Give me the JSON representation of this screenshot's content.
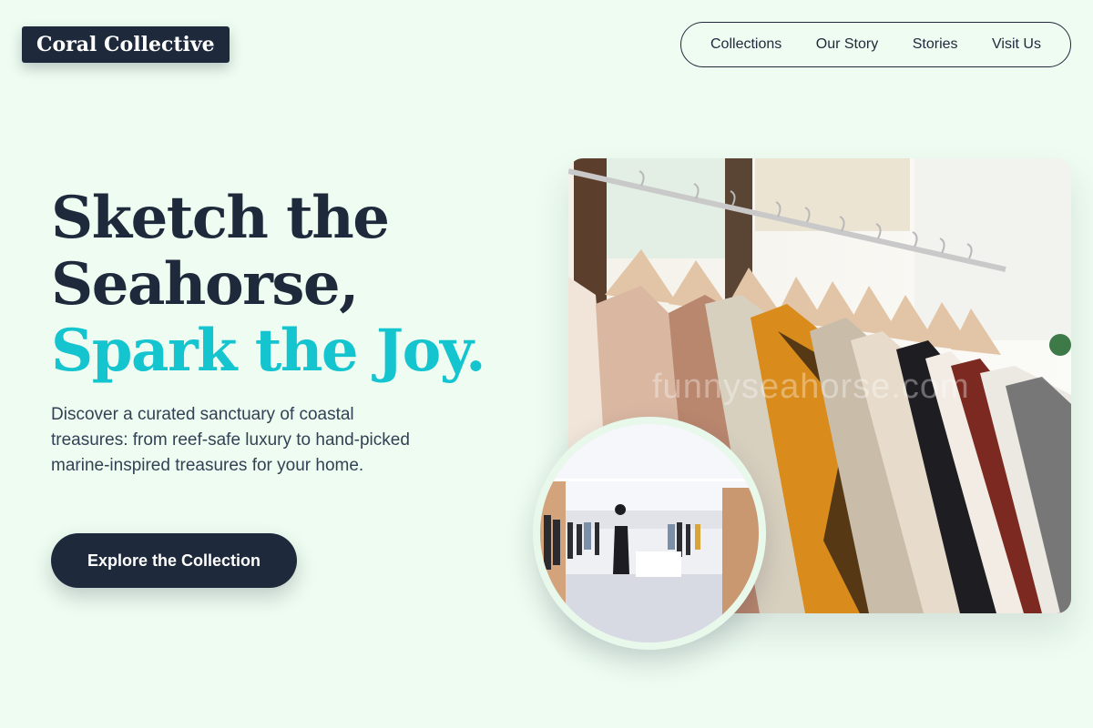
{
  "brand": {
    "name": "Coral Collective"
  },
  "nav": {
    "items": [
      {
        "label": "Collections"
      },
      {
        "label": "Our Story"
      },
      {
        "label": "Stories"
      },
      {
        "label": "Visit Us"
      }
    ]
  },
  "hero": {
    "headline_line1": "Sketch the",
    "headline_line2": "Seahorse,",
    "headline_line3": "Spark the Joy.",
    "description": "Discover a curated sanctuary of coastal treasures: from reef-safe luxury to hand-picked marine-inspired treasures for your home.",
    "cta_label": "Explore the Collection",
    "watermark": "funnyseahorse.com"
  },
  "colors": {
    "background": "#eefcf1",
    "primary": "#1e293b",
    "accent": "#14c4cf"
  }
}
